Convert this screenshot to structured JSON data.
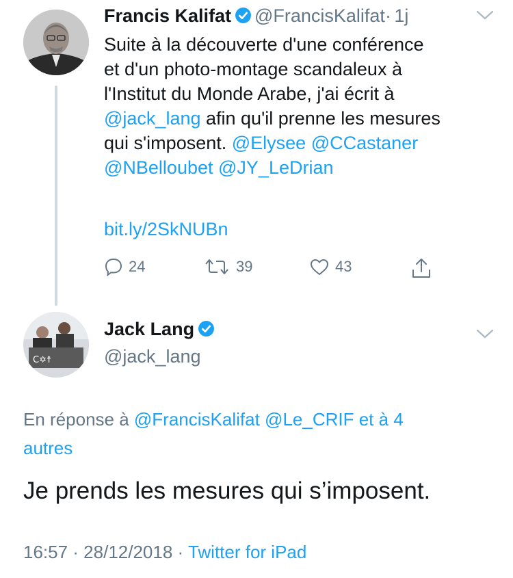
{
  "tweet1": {
    "name": "Francis Kalifat",
    "handle": "@FrancisKalifat",
    "time_sep": "·",
    "time": "1j",
    "lines": [
      [
        {
          "t": "Suite à la découverte d'une conférence",
          "m": false
        }
      ],
      [
        {
          "t": "et d'un photo-montage scandaleux à",
          "m": false
        }
      ],
      [
        {
          "t": "l'Institut du Monde Arabe, j'ai écrit à",
          "m": false
        }
      ],
      [
        {
          "t": "@jack_lang",
          "m": true
        },
        {
          "t": " afin qu'il prenne les mesures",
          "m": false
        }
      ],
      [
        {
          "t": "qui s'imposent. ",
          "m": false
        },
        {
          "t": "@Elysee",
          "m": true
        },
        {
          "t": " ",
          "m": false
        },
        {
          "t": "@CCastaner",
          "m": true
        }
      ],
      [
        {
          "t": "@NBelloubet",
          "m": true
        },
        {
          "t": " ",
          "m": false
        },
        {
          "t": "@JY_LeDrian",
          "m": true
        }
      ]
    ],
    "link": "bit.ly/2SkNUBn",
    "replies": "24",
    "retweets": "39",
    "likes": "43"
  },
  "tweet2": {
    "name": "Jack Lang",
    "handle": "@jack_lang",
    "reply_prefix": "En réponse à",
    "reply_mention1": "@FrancisKalifat",
    "reply_mention2": "@Le_CRIF",
    "reply_and": "et à 4",
    "reply_others": "autres",
    "text": "Je prends les mesures qui s’imposent.",
    "date": "16:57 · 28/12/2018 ·",
    "source": "Twitter for iPad"
  },
  "colors": {
    "link_blue": "#1da1f2",
    "gray_text": "#657786",
    "thread_line": "#cfd9de"
  },
  "icons": [
    "verified-badge-icon",
    "chevron-down-icon",
    "reply-icon",
    "retweet-icon",
    "like-icon",
    "share-icon"
  ]
}
